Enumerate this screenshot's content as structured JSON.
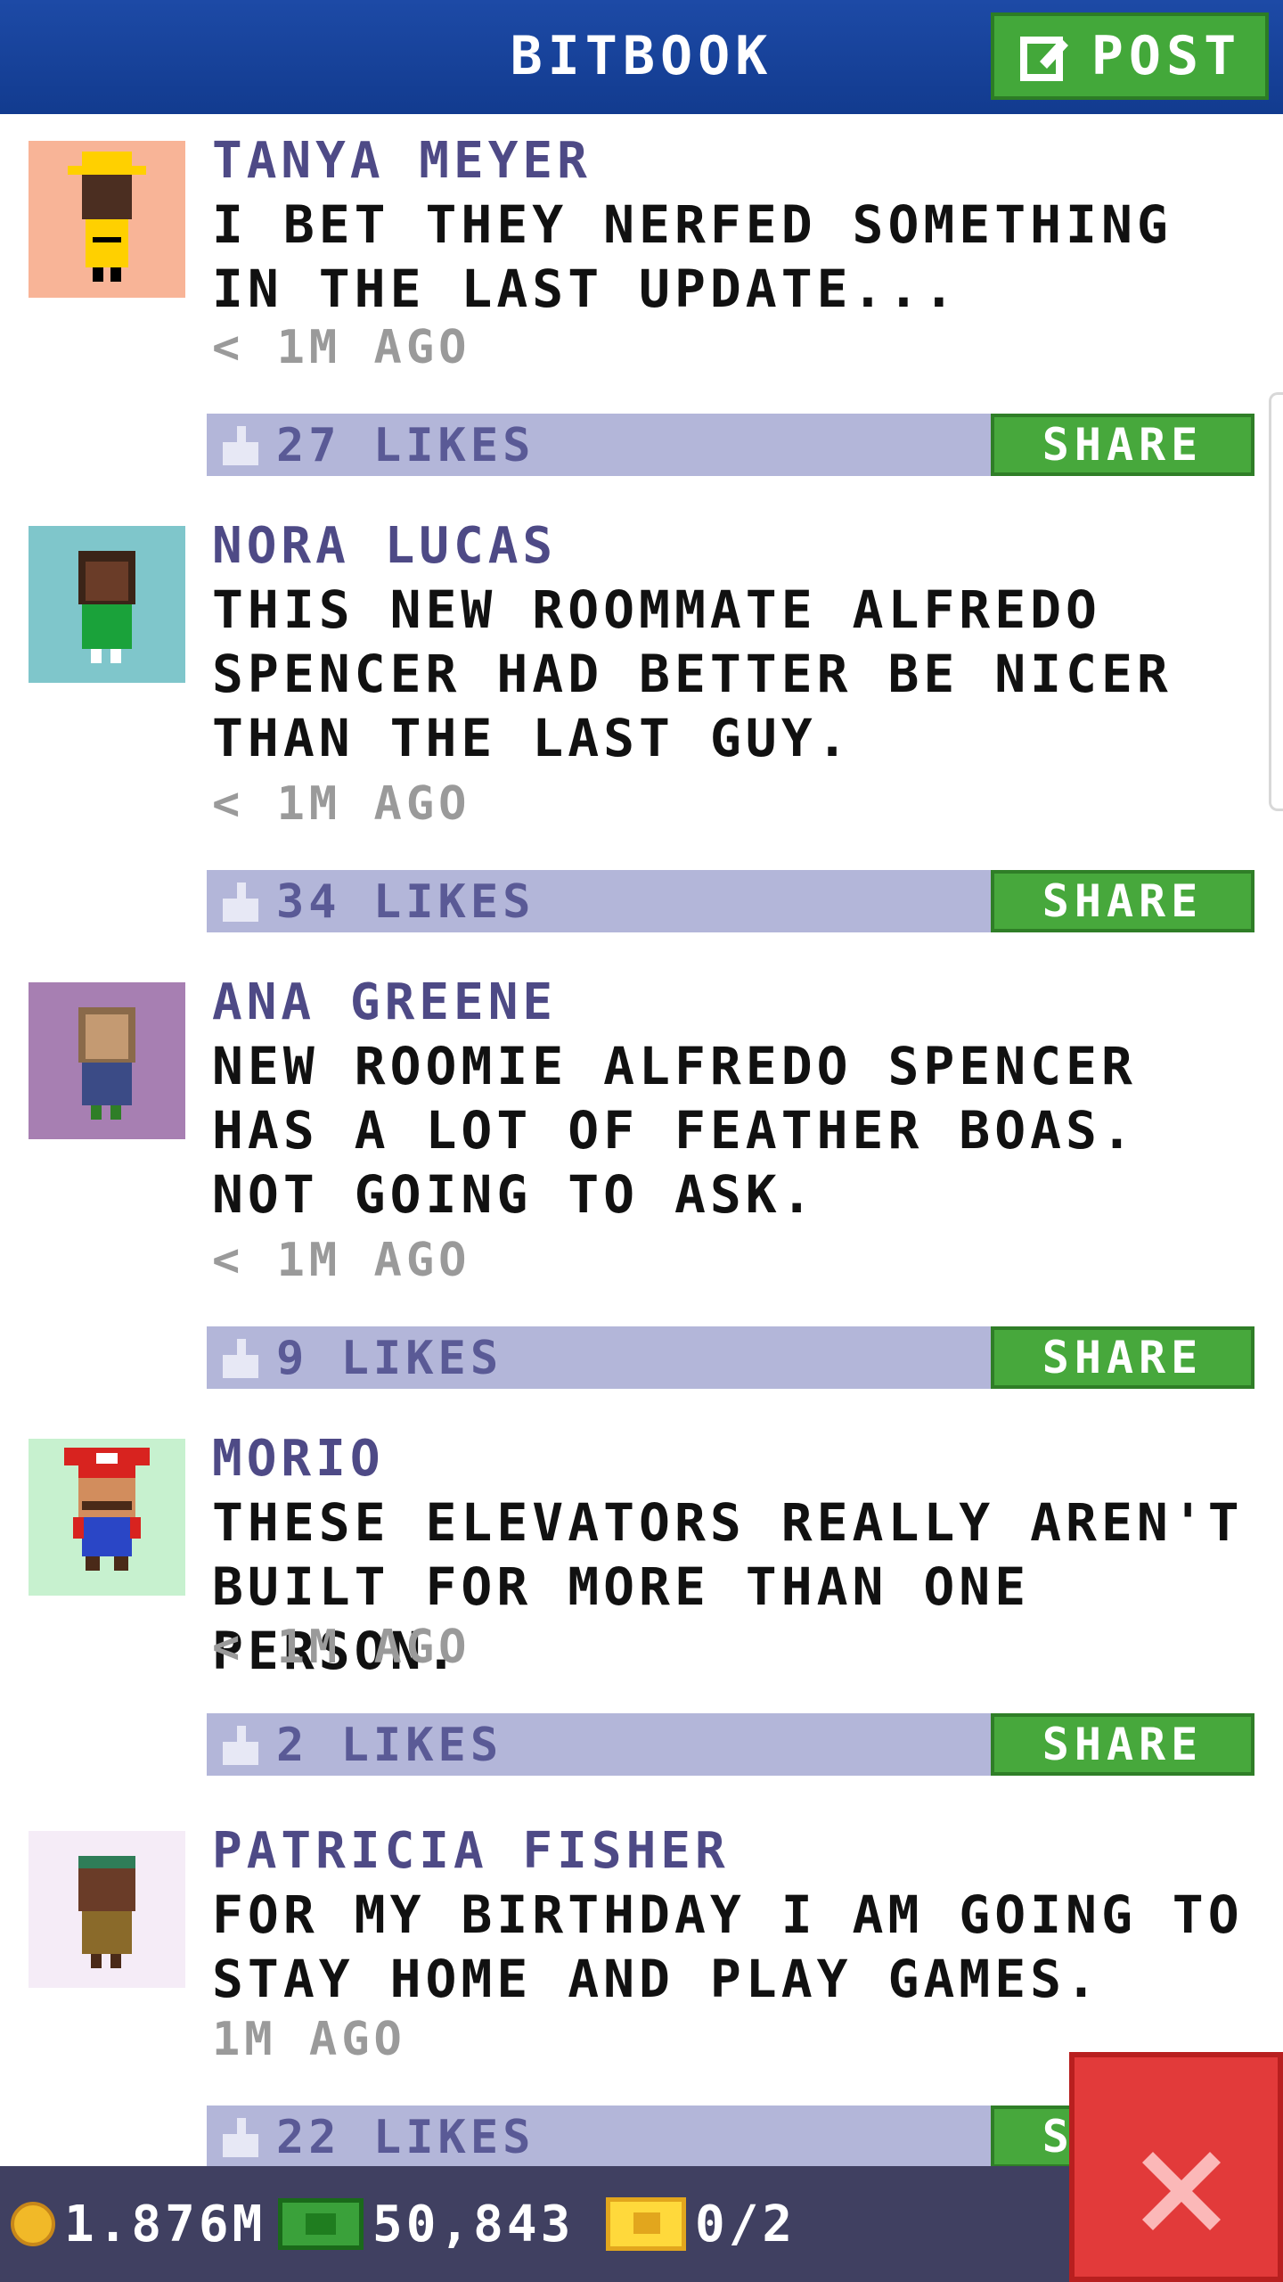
{
  "header": {
    "title": "BITBOOK",
    "post_label": "POST"
  },
  "posts": [
    {
      "name": "TANYA MEYER",
      "text": "I BET THEY NERFED SOMETHING IN THE LAST UPDATE...",
      "time": "< 1M AGO",
      "likes": "27 LIKES",
      "share": "SHARE",
      "avatar_bg": "#f8b497"
    },
    {
      "name": "NORA LUCAS",
      "text": "THIS NEW ROOMMATE ALFREDO SPENCER HAD BETTER BE NICER THAN THE LAST GUY.",
      "time": "< 1M AGO",
      "likes": "34 LIKES",
      "share": "SHARE",
      "avatar_bg": "#7fc6cb"
    },
    {
      "name": "ANA GREENE",
      "text": "NEW ROOMIE ALFREDO SPENCER HAS A LOT OF FEATHER BOAS. NOT GOING TO ASK.",
      "time": "< 1M AGO",
      "likes": "9 LIKES",
      "share": "SHARE",
      "avatar_bg": "#a77fb2"
    },
    {
      "name": "MORIO",
      "text": "THESE ELEVATORS REALLY AREN'T BUILT FOR MORE THAN ONE PERSON.",
      "time": "< 1M AGO",
      "likes": "2 LIKES",
      "share": "SHARE",
      "avatar_bg": "#c7f1cf"
    },
    {
      "name": "PATRICIA FISHER",
      "text": "FOR MY BIRTHDAY I AM GOING TO STAY HOME AND PLAY GAMES.",
      "time": "1M AGO",
      "likes": "22 LIKES",
      "share": "SHARE",
      "avatar_bg": "#f5ecf7"
    }
  ],
  "bottom": {
    "coins": "1.876M",
    "bux": "50,843",
    "tickets": "0/2"
  },
  "colors": {
    "header_blue": "#1a47a1",
    "post_green": "#43a83a",
    "likebar": "#b3b6d9",
    "name_purple": "#4e4a86",
    "close_red": "#e23a3a",
    "bottombar": "#404061"
  },
  "icons": {
    "post": "edit-icon",
    "like": "thumb-up-icon",
    "close": "close-icon",
    "coin": "coin-icon",
    "bux": "cash-icon",
    "ticket": "ticket-icon"
  }
}
